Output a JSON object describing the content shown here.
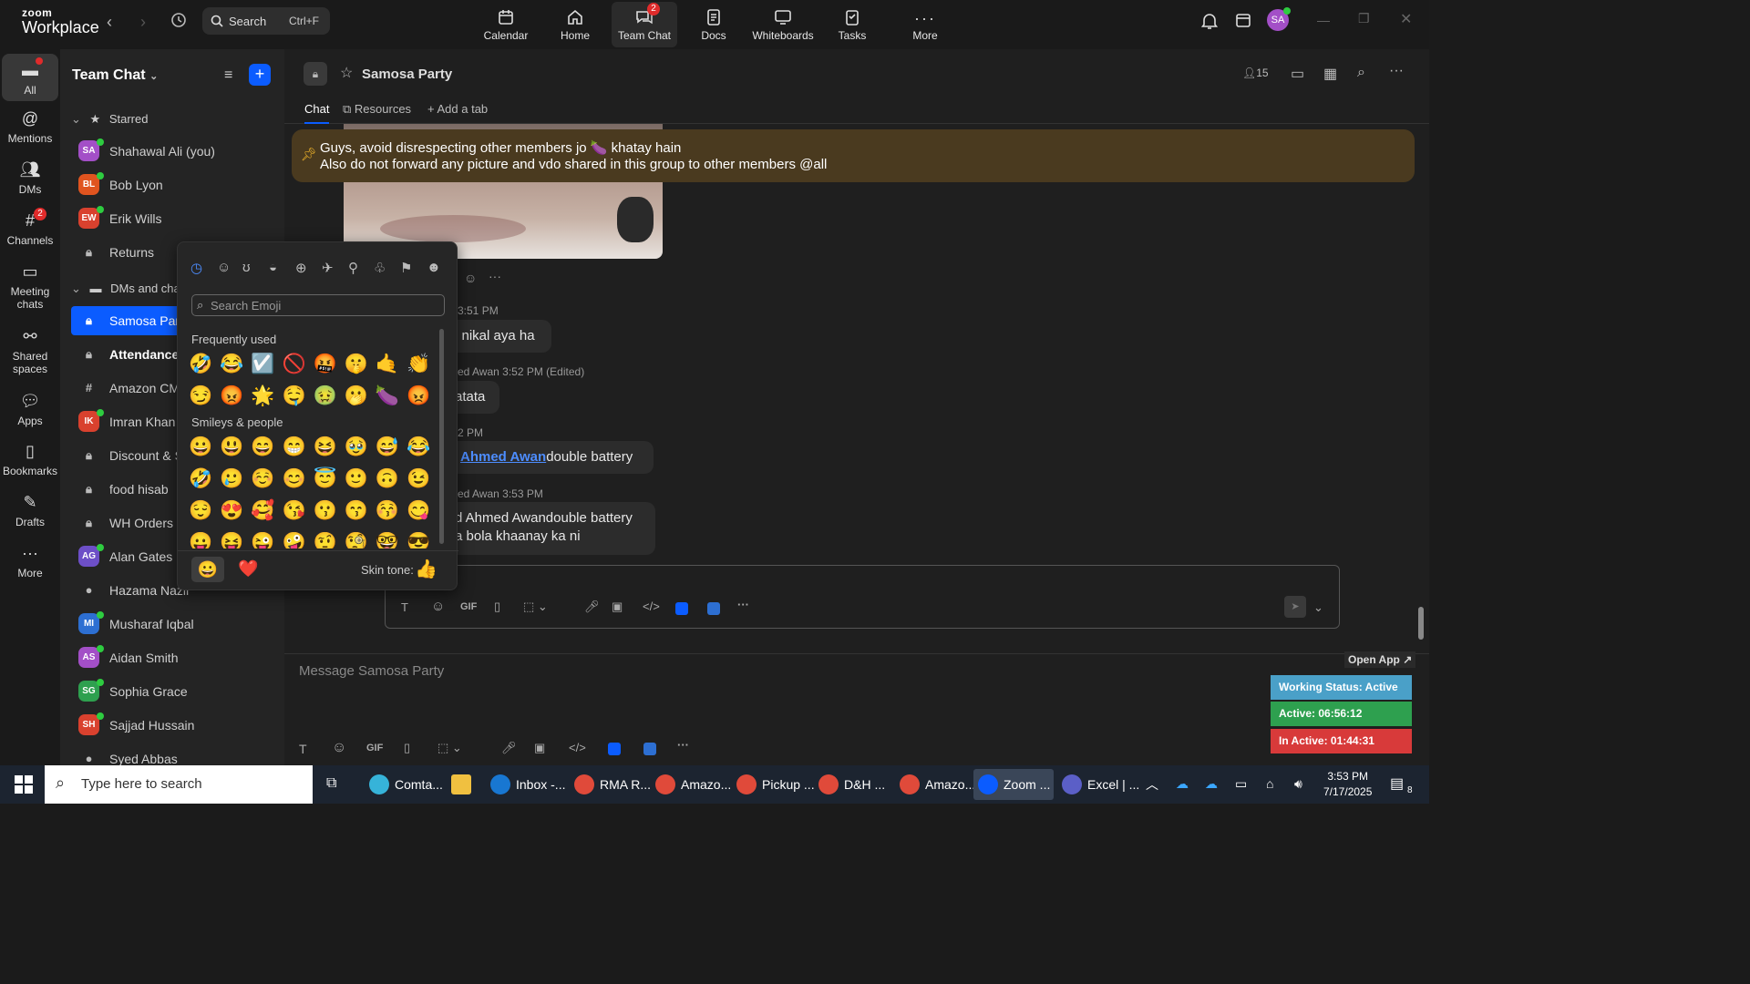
{
  "app": {
    "logo_top": "zoom",
    "logo_bottom": "Workplace"
  },
  "topbar": {
    "search_label": "Search",
    "search_shortcut": "Ctrl+F",
    "nav": [
      {
        "label": "Calendar"
      },
      {
        "label": "Home"
      },
      {
        "label": "Team Chat",
        "badge": "2"
      },
      {
        "label": "Docs"
      },
      {
        "label": "Whiteboards"
      },
      {
        "label": "Tasks"
      },
      {
        "label": "More"
      }
    ],
    "avatar_initials": "SA"
  },
  "rail": {
    "items": [
      {
        "label": "All"
      },
      {
        "label": "Mentions"
      },
      {
        "label": "DMs"
      },
      {
        "label": "Channels",
        "badge": "2"
      },
      {
        "label": "Meeting chats"
      },
      {
        "label": "Shared spaces"
      },
      {
        "label": "Apps"
      },
      {
        "label": "Bookmarks"
      },
      {
        "label": "Drafts"
      },
      {
        "label": "More"
      }
    ]
  },
  "sidebar": {
    "title": "Team Chat",
    "starred_label": "Starred",
    "dms_label": "DMs and chan",
    "starred": [
      {
        "initials": "SA",
        "name": "Shahawal Ali (you)",
        "color": "#a34fc7"
      },
      {
        "initials": "BL",
        "name": "Bob Lyon",
        "color": "#e0541f"
      },
      {
        "initials": "EW",
        "name": "Erik Wills",
        "color": "#d9412e"
      },
      {
        "initials": "",
        "name": "Returns",
        "color": "#3a3a3a"
      }
    ],
    "items": [
      {
        "initials": "",
        "name": "Samosa Party",
        "color": "#0b5cff"
      },
      {
        "initials": "",
        "name": "Attendance",
        "color": "#3a3a3a"
      },
      {
        "initials": "",
        "name": "Amazon CMS",
        "color": "#3a3a3a"
      },
      {
        "initials": "IK",
        "name": "Imran Khan",
        "color": "#d9412e"
      },
      {
        "initials": "",
        "name": "Discount & S",
        "color": "#3a3a3a"
      },
      {
        "initials": "",
        "name": "food hisab",
        "color": "#3a3a3a"
      },
      {
        "initials": "",
        "name": "WH Orders",
        "color": "#3a3a3a"
      },
      {
        "initials": "AG",
        "name": "Alan Gates",
        "color": "#6d4fc7"
      },
      {
        "initials": "",
        "name": "Hazama Nazir",
        "color": "#5a3a3a"
      },
      {
        "initials": "MI",
        "name": "Musharaf Iqbal",
        "color": "#2d6fd2"
      },
      {
        "initials": "AS",
        "name": "Aidan Smith",
        "color": "#a34fc7"
      },
      {
        "initials": "SG",
        "name": "Sophia Grace",
        "color": "#2ea04f"
      },
      {
        "initials": "SH",
        "name": "Sajjad Hussain",
        "color": "#d9412e"
      },
      {
        "initials": "",
        "name": "Syed Abbas",
        "color": "#333333"
      }
    ]
  },
  "channel": {
    "name": "Samosa Party",
    "member_count": "15",
    "tabs": [
      {
        "label": "Chat"
      },
      {
        "label": "Resources"
      },
      {
        "label": "Add a tab"
      }
    ],
    "pinned_line1": "Guys, avoid disrespecting other members jo 🍆 khatay hain",
    "pinned_line2": "Also do not forward any picture and vdo shared in this group to other members @all",
    "messages": [
      {
        "meta": "3:51 PM",
        "text": "l nikal aya ha"
      },
      {
        "meta": "ed Awan 3:52 PM (Edited)",
        "text": "atata"
      },
      {
        "meta": "2 PM",
        "mention": "Ahmed Awan",
        "text": "double battery"
      },
      {
        "meta": "ed Awan 3:53 PM",
        "text": "d Ahmed Awandouble battery",
        "text2": "a bola khaanay ka ni"
      }
    ],
    "composer_placeholder": "Message Samosa Party"
  },
  "emoji_picker": {
    "search_placeholder": "Search Emoji",
    "section_frequent": "Frequently used",
    "section_smileys": "Smileys & people",
    "frequent_rows": [
      [
        "🤣",
        "😂",
        "☑️",
        "🚫",
        "🤬",
        "🤫",
        "🤙",
        "👏"
      ],
      [
        "😏",
        "😡",
        "🌟",
        "🤤",
        "🤢",
        "🫢",
        "🍆",
        "😡"
      ]
    ],
    "smiley_rows": [
      [
        "😀",
        "😃",
        "😄",
        "😁",
        "😆",
        "🥹",
        "😅",
        "😂"
      ],
      [
        "🤣",
        "🥲",
        "☺️",
        "😊",
        "😇",
        "🙂",
        "🙃",
        "😉"
      ],
      [
        "😌",
        "😍",
        "🥰",
        "😘",
        "😗",
        "😙",
        "😚",
        "😋"
      ],
      [
        "😛",
        "😝",
        "😜",
        "🤪",
        "🤨",
        "🧐",
        "🤓",
        "😎"
      ]
    ],
    "skin_tone_label": "Skin tone:",
    "skin_tone_emoji": "👍",
    "footer_smiley": "😀",
    "footer_heart": "❤️"
  },
  "status_widget": {
    "open_app": "Open App ↗",
    "working_status": "Working Status: Active",
    "active": "Active: 06:56:12",
    "inactive": "In Active: 01:44:31"
  },
  "taskbar": {
    "search_placeholder": "Type here to search",
    "apps": [
      {
        "label": "Comta...",
        "color": "#36b3d9"
      },
      {
        "label": "",
        "color": "#f0c040"
      },
      {
        "label": "Inbox -...",
        "color": "#1877d2"
      },
      {
        "label": "RMA R...",
        "color": "#e04a3a"
      },
      {
        "label": "Amazo...",
        "color": "#e04a3a"
      },
      {
        "label": "Pickup ...",
        "color": "#e04a3a"
      },
      {
        "label": "D&H ...",
        "color": "#e04a3a"
      },
      {
        "label": "Amazo...",
        "color": "#e04a3a"
      },
      {
        "label": "Zoom ...",
        "color": "#0b5cff"
      },
      {
        "label": "Excel | ...",
        "color": "#5b5fc7"
      }
    ],
    "time": "3:53 PM",
    "date": "7/17/2025",
    "notif_count": "8"
  },
  "colors": {
    "accent": "#0b5cff",
    "pinned_bg": "#4a3a1f",
    "status_active_bg": "#2ea04f",
    "status_inactive_bg": "#d83a3a"
  }
}
